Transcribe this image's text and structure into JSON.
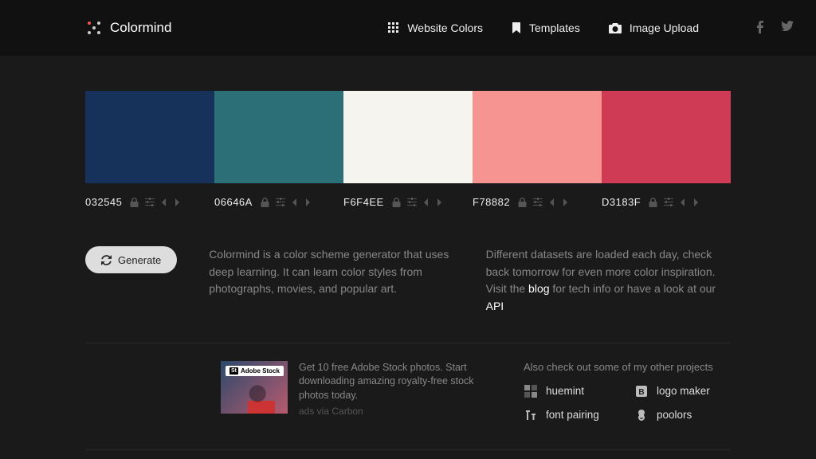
{
  "brand": {
    "name": "Colormind"
  },
  "nav": {
    "website_colors": "Website Colors",
    "templates": "Templates",
    "image_upload": "Image Upload"
  },
  "palette": [
    {
      "hex": "032545",
      "color": "#17325a"
    },
    {
      "hex": "06646A",
      "color": "#2d6f76"
    },
    {
      "hex": "F6F4EE",
      "color": "#f6f4ee"
    },
    {
      "hex": "F78882",
      "color": "#f59491"
    },
    {
      "hex": "D3183F",
      "color": "#cf3a55"
    }
  ],
  "generate_label": "Generate",
  "description_left": "Colormind is a color scheme generator that uses deep learning. It can learn color styles from photographs, movies, and popular art.",
  "description_right_pre": "Different datasets are loaded each day, check back tomorrow for even more color inspiration. Visit the ",
  "description_right_blog": "blog",
  "description_right_mid": " for tech info or have a look at our ",
  "description_right_api": "API",
  "ad": {
    "badge": "Adobe Stock",
    "text": "Get 10 free Adobe Stock photos. Start downloading amazing royalty-free stock photos today.",
    "sub": "ads via Carbon"
  },
  "projects_title": "Also check out some of my other projects",
  "projects": {
    "huemint": "huemint",
    "logo_maker": "logo maker",
    "font_pairing": "font pairing",
    "poolors": "poolors"
  }
}
